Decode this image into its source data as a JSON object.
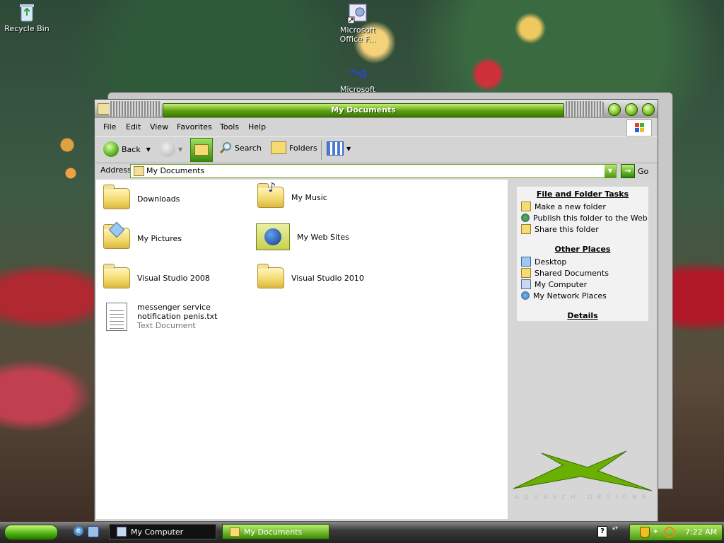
{
  "desktop": {
    "icons": [
      {
        "label": "Recycle Bin",
        "icon": "recycle-bin-icon"
      },
      {
        "label": "Microsoft Office F...",
        "icon": "office-shortcut-icon"
      },
      {
        "label": "Microsoft Visual",
        "icon": "visual-studio-icon"
      }
    ]
  },
  "window": {
    "title": "My Documents",
    "menu": [
      "File",
      "Edit",
      "View",
      "Favorites",
      "Tools",
      "Help"
    ],
    "toolbar": {
      "back": "Back",
      "search": "Search",
      "folders": "Folders"
    },
    "address": {
      "label": "Address",
      "value": "My Documents",
      "go": "Go"
    },
    "items": [
      {
        "name": "Downloads",
        "icon": "folder-icon"
      },
      {
        "name": "My Music",
        "icon": "music-folder-icon"
      },
      {
        "name": "My Pictures",
        "icon": "pictures-folder-icon"
      },
      {
        "name": "My Web Sites",
        "icon": "web-folder-icon"
      },
      {
        "name": "Visual Studio 2008",
        "icon": "folder-icon"
      },
      {
        "name": "Visual Studio 2010",
        "icon": "folder-icon"
      },
      {
        "name": "messenger service notification penis.txt",
        "type": "Text Document",
        "icon": "text-file-icon"
      }
    ],
    "sidebar": {
      "file_tasks": {
        "title": "File and Folder Tasks",
        "links": [
          "Make a new folder",
          "Publish this folder to the Web",
          "Share this folder"
        ]
      },
      "other_places": {
        "title": "Other Places",
        "links": [
          "Desktop",
          "Shared Documents",
          "My Computer",
          "My Network Places"
        ]
      },
      "details": {
        "title": "Details"
      },
      "watermark": "AQUAXCH DESIGNS"
    }
  },
  "taskbar": {
    "tasks": [
      "My Computer",
      "My Documents"
    ],
    "clock": "7:22 AM"
  },
  "colors": {
    "accent_green": "#5aa010",
    "window_gray": "#d4d4d4"
  }
}
